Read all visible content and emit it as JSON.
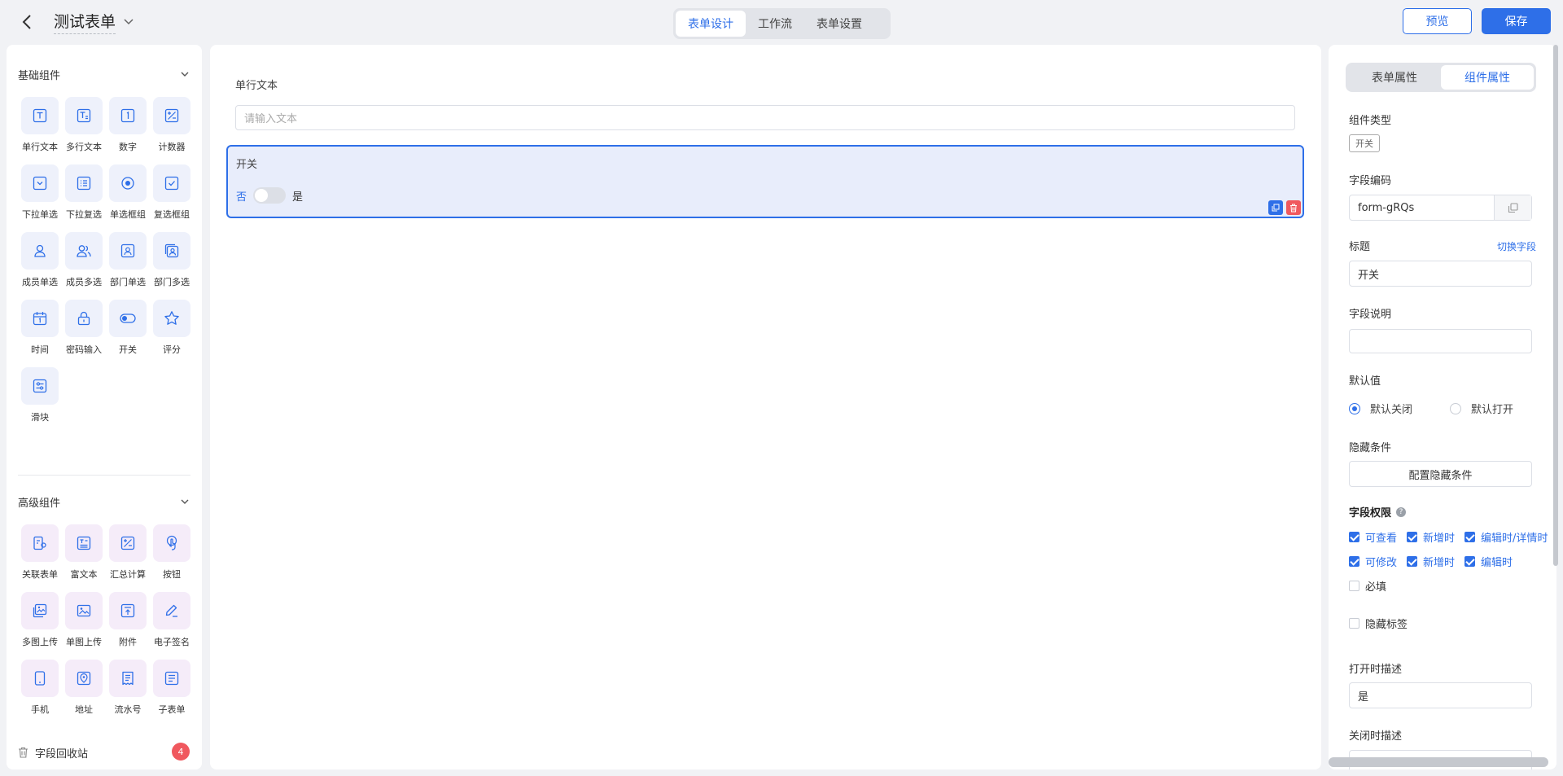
{
  "header": {
    "title": "测试表单",
    "tabs": [
      {
        "label": "表单设计",
        "active": true
      },
      {
        "label": "工作流",
        "active": false
      },
      {
        "label": "表单设置",
        "active": false
      }
    ],
    "preview_label": "预览",
    "save_label": "保存"
  },
  "left": {
    "basic_title": "基础组件",
    "basic": [
      {
        "label": "单行文本",
        "icon": "text-icon"
      },
      {
        "label": "多行文本",
        "icon": "multiline-text-icon"
      },
      {
        "label": "数字",
        "icon": "number-icon"
      },
      {
        "label": "计数器",
        "icon": "counter-icon"
      },
      {
        "label": "下拉单选",
        "icon": "dropdown-icon"
      },
      {
        "label": "下拉复选",
        "icon": "list-icon"
      },
      {
        "label": "单选框组",
        "icon": "radio-icon"
      },
      {
        "label": "复选框组",
        "icon": "checkbox-icon"
      },
      {
        "label": "成员单选",
        "icon": "user-icon"
      },
      {
        "label": "成员多选",
        "icon": "users-icon"
      },
      {
        "label": "部门单选",
        "icon": "department-icon"
      },
      {
        "label": "部门多选",
        "icon": "departments-icon"
      },
      {
        "label": "时间",
        "icon": "calendar-icon"
      },
      {
        "label": "密码输入",
        "icon": "lock-icon"
      },
      {
        "label": "开关",
        "icon": "toggle-icon"
      },
      {
        "label": "评分",
        "icon": "star-icon"
      },
      {
        "label": "滑块",
        "icon": "slider-icon"
      }
    ],
    "advanced_title": "高级组件",
    "advanced": [
      {
        "label": "关联表单",
        "icon": "link-form-icon"
      },
      {
        "label": "富文本",
        "icon": "richtext-icon"
      },
      {
        "label": "汇总计算",
        "icon": "calc-icon"
      },
      {
        "label": "按钮",
        "icon": "pointer-icon"
      },
      {
        "label": "多图上传",
        "icon": "images-icon"
      },
      {
        "label": "单图上传",
        "icon": "image-icon"
      },
      {
        "label": "附件",
        "icon": "upload-icon"
      },
      {
        "label": "电子签名",
        "icon": "pen-icon"
      },
      {
        "label": "手机",
        "icon": "phone-icon"
      },
      {
        "label": "地址",
        "icon": "location-icon"
      },
      {
        "label": "流水号",
        "icon": "receipt-icon"
      },
      {
        "label": "子表单",
        "icon": "subform-icon"
      }
    ],
    "recycle_label": "字段回收站",
    "recycle_count": "4"
  },
  "canvas": {
    "field1_label": "单行文本",
    "field1_placeholder": "请输入文本",
    "field2_label": "开关",
    "switch_off": "否",
    "switch_on": "是"
  },
  "right": {
    "tabs": [
      {
        "label": "表单属性",
        "active": false
      },
      {
        "label": "组件属性",
        "active": true
      }
    ],
    "type_label": "组件类型",
    "type_value": "开关",
    "code_label": "字段编码",
    "code_value": "form-gRQs",
    "title_label": "标题",
    "switch_field": "切换字段",
    "title_value": "开关",
    "desc_label": "字段说明",
    "default_label": "默认值",
    "default_off": "默认关闭",
    "default_on": "默认打开",
    "hide_label": "隐藏条件",
    "hide_btn": "配置隐藏条件",
    "perm_label": "字段权限",
    "perm_view": "可查看",
    "perm_add": "新增时",
    "perm_edit_detail": "编辑时/详情时",
    "perm_modify": "可修改",
    "perm_add2": "新增时",
    "perm_edit": "编辑时",
    "required": "必填",
    "hide_tag": "隐藏标签",
    "open_desc_label": "打开时描述",
    "open_desc_value": "是",
    "close_desc_label": "关闭时描述"
  },
  "colors": {
    "accent": "#2e6fe8",
    "danger": "#f0585e"
  }
}
